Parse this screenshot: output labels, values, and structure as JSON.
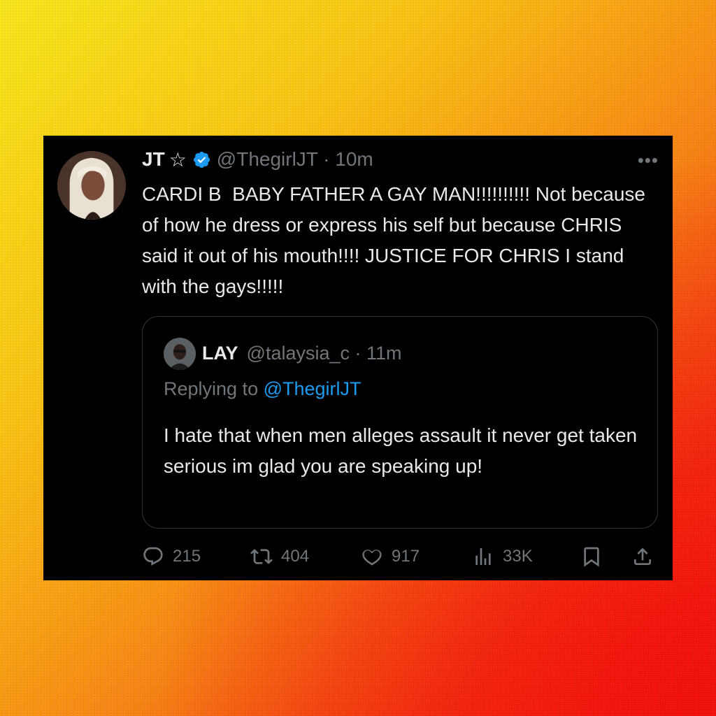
{
  "tweet": {
    "author_name": "JT",
    "star_glyph": "☆",
    "handle_time": "@ThegirlJT · 10m",
    "more_glyph": "•••",
    "text": "CARDI B  BABY FATHER A GAY MAN!!!!!!!!!! Not because of how he dress or express his self but because CHRIS said it out of his mouth!!!! JUSTICE FOR CHRIS I stand with the gays!!!!!"
  },
  "quoted": {
    "author_name": "LAY",
    "handle_time": "@talaysia_c · 11m",
    "replying_prefix": "Replying to ",
    "replying_handle": "@ThegirlJT",
    "text": "I hate that when men alleges assault it never get taken serious im glad you are speaking up!"
  },
  "actions": {
    "replies": "215",
    "reposts": "404",
    "likes": "917",
    "views": "33K"
  },
  "icons": {
    "reply": "reply-icon",
    "repost": "repost-icon",
    "like": "heart-icon",
    "views": "views-icon",
    "bookmark": "bookmark-icon",
    "share": "share-icon",
    "verified": "verified-badge-icon"
  },
  "colors": {
    "card_bg": "#000000",
    "text": "#e7e9ea",
    "muted": "#71767b",
    "accent": "#1d9bf0",
    "gradient_top_left": "#f6e616",
    "gradient_bottom_right": "#ee1505"
  }
}
